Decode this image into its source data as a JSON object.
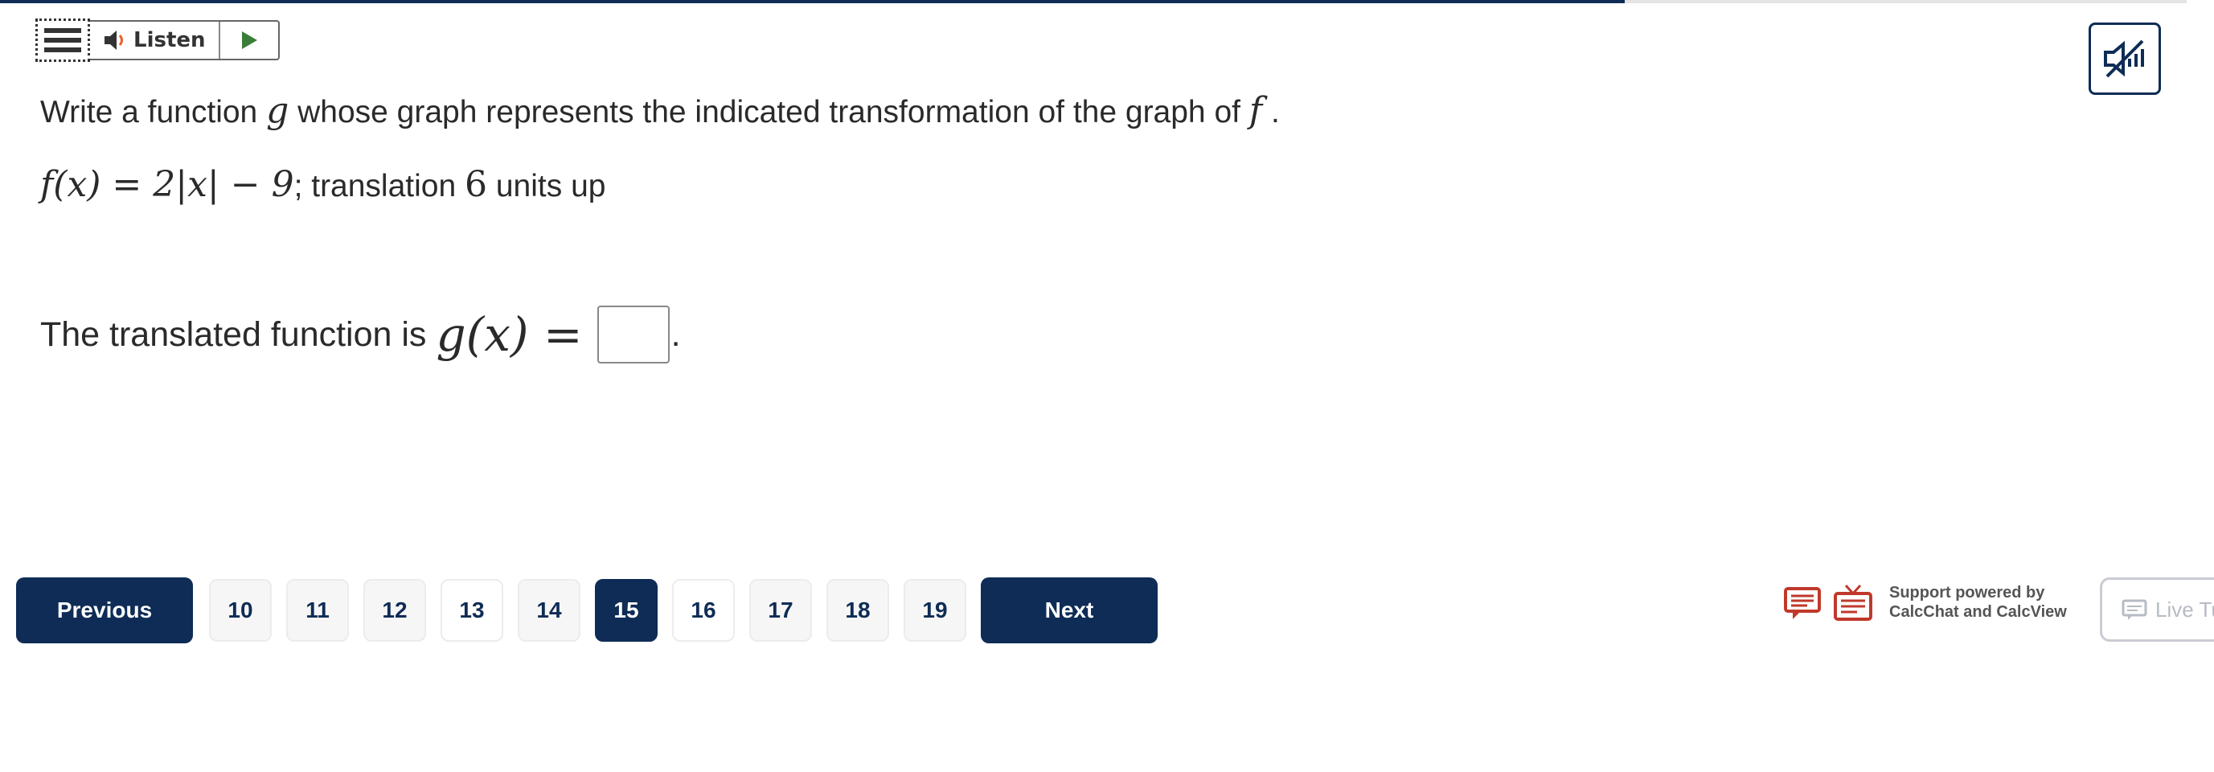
{
  "progress": {
    "fraction": 0.743
  },
  "toolbar": {
    "listen_label": "Listen"
  },
  "question": {
    "prompt_before": "Write a function",
    "prompt_var_g": "g",
    "prompt_middle": "whose graph represents the indicated transformation of the graph of",
    "prompt_var_f": "f",
    "prompt_end": ".",
    "func_lhs": "f(x) = 2|x| − 9",
    "func_rest": "; translation",
    "func_amount": "6",
    "func_units": "units up",
    "answer_prefix": "The translated function is",
    "answer_func": "g(x) =",
    "answer_suffix": "."
  },
  "pager": {
    "previous_label": "Previous",
    "next_label": "Next",
    "pages": [
      "10",
      "11",
      "12",
      "13",
      "14",
      "15",
      "16",
      "17",
      "18",
      "19"
    ],
    "current": "15"
  },
  "support": {
    "line1": "Support powered by",
    "line2": "CalcChat and CalcView",
    "live_label": "Live Tu"
  },
  "colors": {
    "navy": "#0e2c55",
    "support_red": "#c0392b",
    "play_green": "#3a7d3a"
  }
}
